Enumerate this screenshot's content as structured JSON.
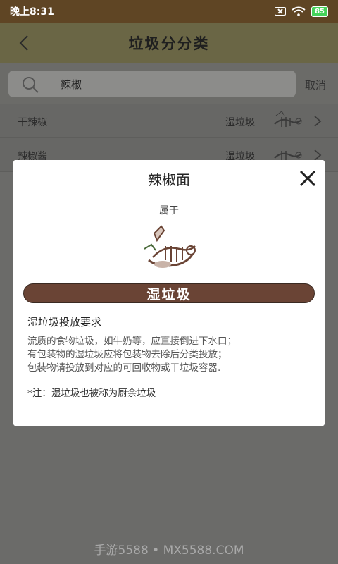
{
  "status_bar": {
    "time": "晚上8:31",
    "battery": "85"
  },
  "app_bar": {
    "title": "垃圾分分类"
  },
  "search": {
    "query": "辣椒",
    "cancel_label": "取消"
  },
  "results": [
    {
      "name": "干辣椒",
      "category": "湿垃圾"
    },
    {
      "name": "辣椒酱",
      "category": "湿垃圾"
    }
  ],
  "dialog": {
    "title": "辣椒面",
    "belongs_label": "属于",
    "category_name": "湿垃圾",
    "requirement_title": "湿垃圾投放要求",
    "requirement_lines": [
      "流质的食物垃圾，如牛奶等，应直接倒进下水口；",
      "有包装物的湿垃圾应将包装物去除后分类投放；",
      "包装物请投放到对应的可回收物或干垃圾容器."
    ],
    "note": "*注：湿垃圾也被称为厨余垃圾"
  },
  "watermark": "手游5588 • MX5588.COM",
  "colors": {
    "status_bar": "#5f4524",
    "banner": "#6a4435",
    "battery": "#45d25a"
  }
}
